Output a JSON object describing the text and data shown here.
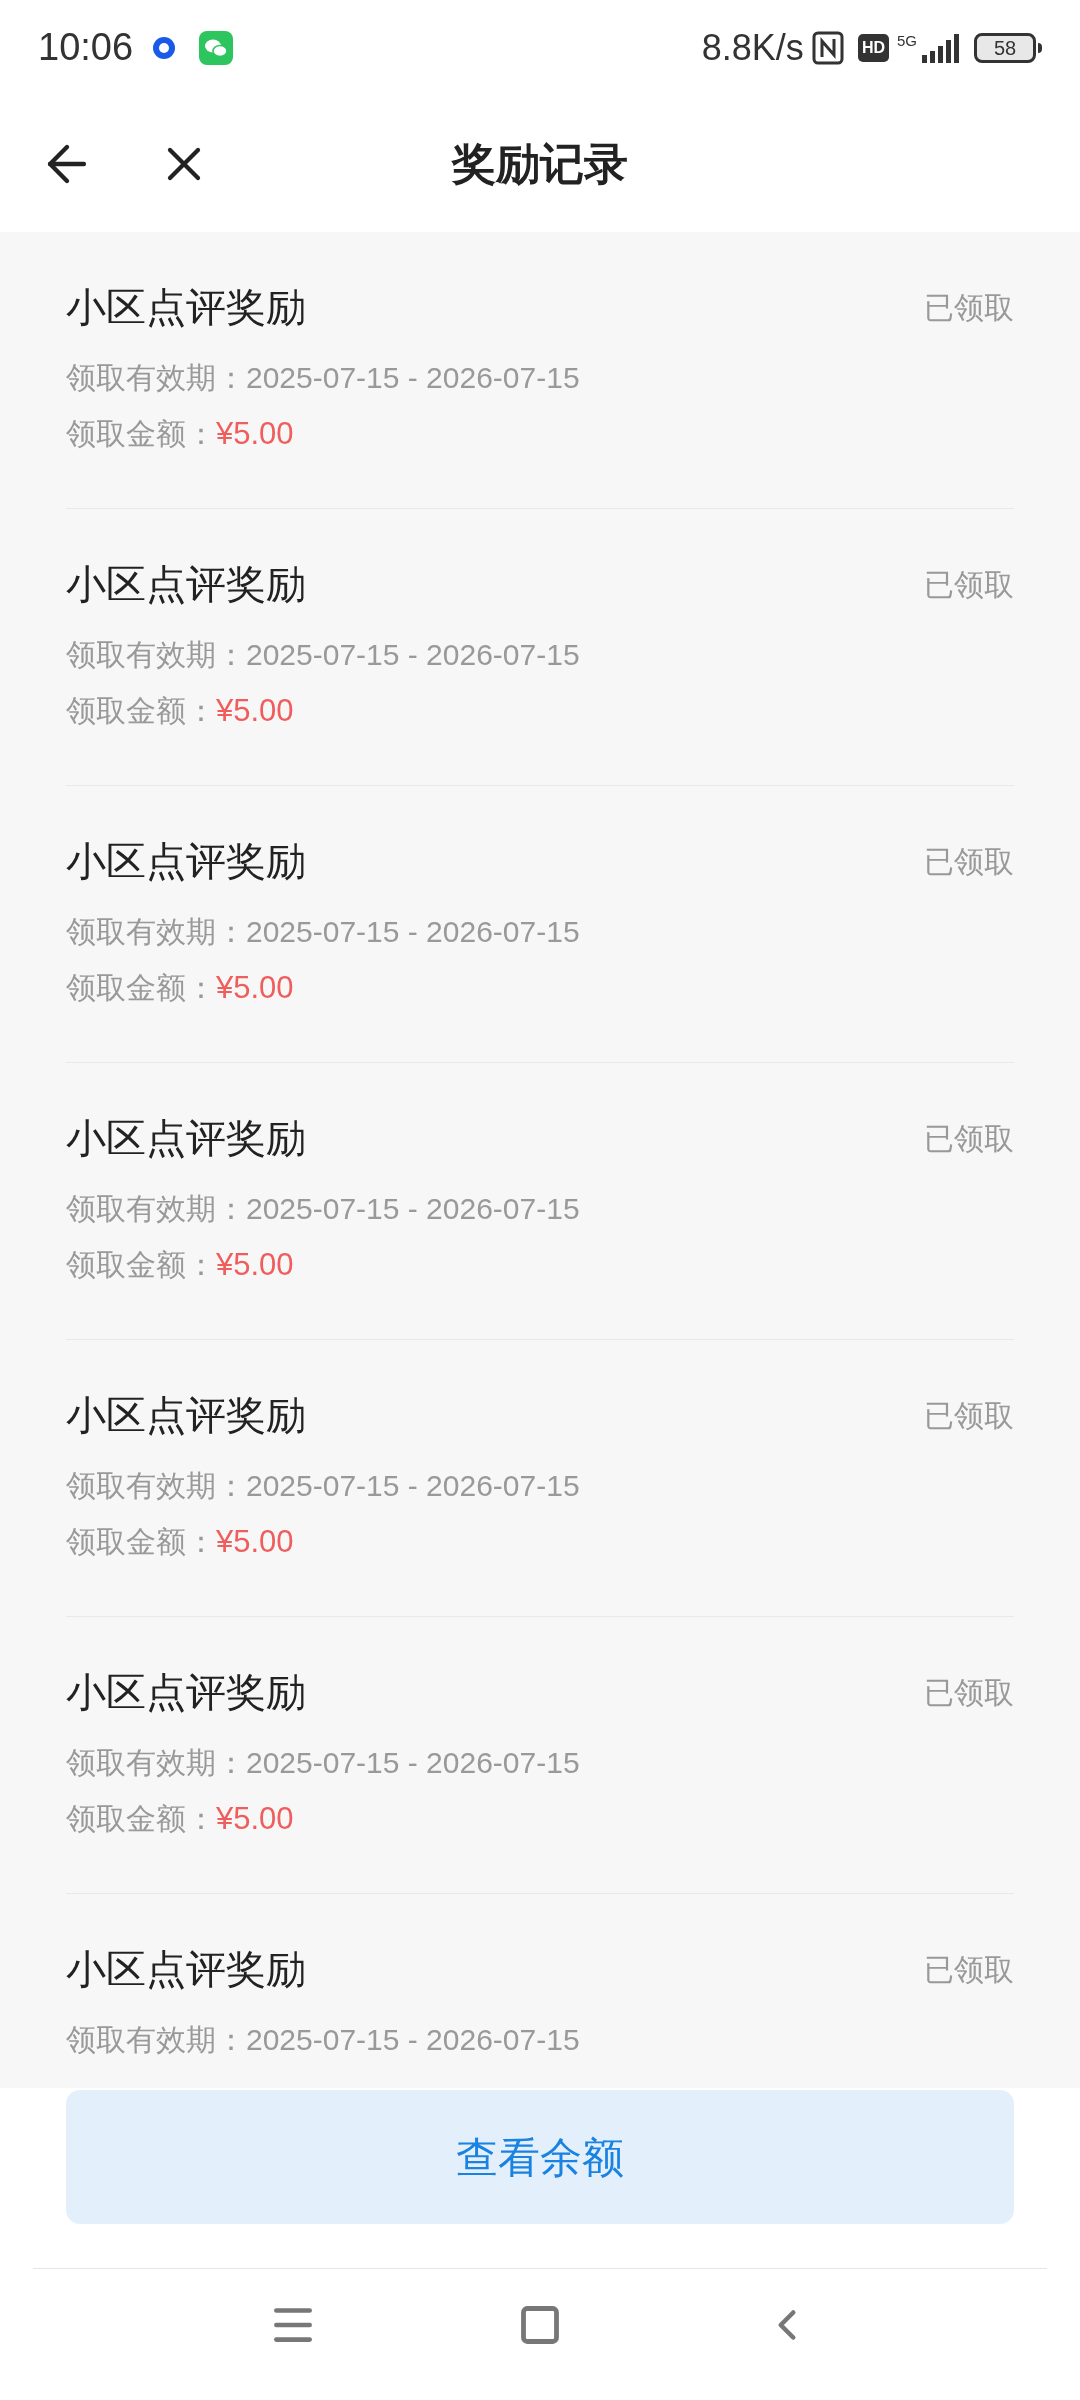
{
  "status_bar": {
    "time": "10:06",
    "network_speed": "8.8K/s",
    "hd": "HD",
    "network_type": "5G",
    "battery": "58"
  },
  "header": {
    "title": "奖励记录"
  },
  "records": [
    {
      "title": "小区点评奖励",
      "status": "已领取",
      "validity": "领取有效期：2025-07-15 - 2026-07-15",
      "amount_label": "领取金额：",
      "amount": "¥5.00"
    },
    {
      "title": "小区点评奖励",
      "status": "已领取",
      "validity": "领取有效期：2025-07-15 - 2026-07-15",
      "amount_label": "领取金额：",
      "amount": "¥5.00"
    },
    {
      "title": "小区点评奖励",
      "status": "已领取",
      "validity": "领取有效期：2025-07-15 - 2026-07-15",
      "amount_label": "领取金额：",
      "amount": "¥5.00"
    },
    {
      "title": "小区点评奖励",
      "status": "已领取",
      "validity": "领取有效期：2025-07-15 - 2026-07-15",
      "amount_label": "领取金额：",
      "amount": "¥5.00"
    },
    {
      "title": "小区点评奖励",
      "status": "已领取",
      "validity": "领取有效期：2025-07-15 - 2026-07-15",
      "amount_label": "领取金额：",
      "amount": "¥5.00"
    },
    {
      "title": "小区点评奖励",
      "status": "已领取",
      "validity": "领取有效期：2025-07-15 - 2026-07-15",
      "amount_label": "领取金额：",
      "amount": "¥5.00"
    },
    {
      "title": "小区点评奖励",
      "status": "已领取",
      "validity": "领取有效期：2025-07-15 - 2026-07-15"
    }
  ],
  "button": {
    "label": "查看余额"
  }
}
